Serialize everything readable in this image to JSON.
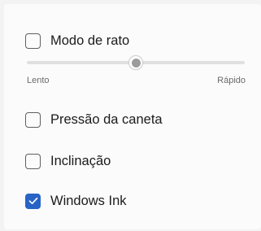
{
  "mouse_mode": {
    "label": "Modo de rato",
    "checked": false,
    "speed": 0.5,
    "slow_label": "Lento",
    "fast_label": "Rápido"
  },
  "pen_pressure": {
    "label": "Pressão da caneta",
    "checked": false
  },
  "tilt": {
    "label": "Inclinação",
    "checked": false
  },
  "windows_ink": {
    "label": "Windows Ink",
    "checked": true
  },
  "colors": {
    "accent": "#2863c6",
    "check": "#ffffff"
  }
}
